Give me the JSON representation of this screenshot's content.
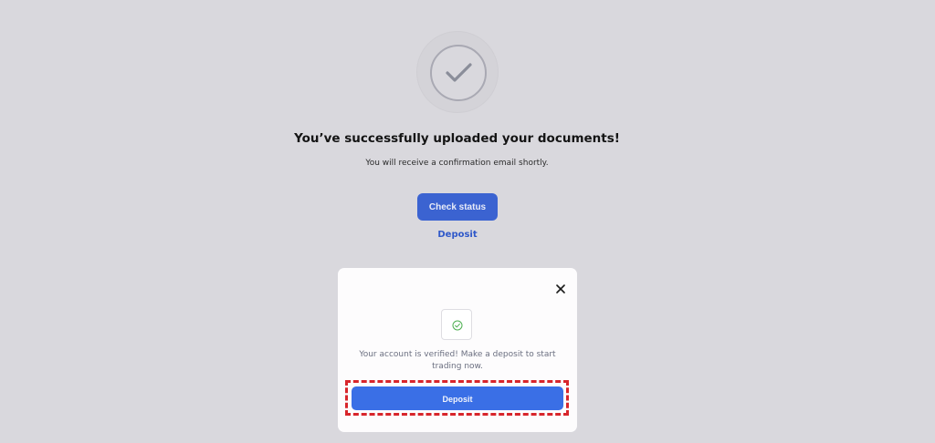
{
  "main": {
    "headline": "You’ve successfully uploaded your documents!",
    "subline": "You will receive a confirmation email shortly.",
    "check_status_label": "Check status",
    "deposit_link_label": "Deposit",
    "success_icon": "checkmark-circle-icon"
  },
  "modal": {
    "close_icon": "close-icon",
    "status_icon": "check-circle-icon",
    "message": "Your account is verified! Make a deposit to start trading now.",
    "deposit_label": "Deposit"
  },
  "colors": {
    "background": "#d9d8dd",
    "primary_button": "#3b63d1",
    "modal_button": "#3a6fe6",
    "link": "#2f58c9",
    "success_green": "#4caf50",
    "highlight_border": "#d8252b"
  }
}
